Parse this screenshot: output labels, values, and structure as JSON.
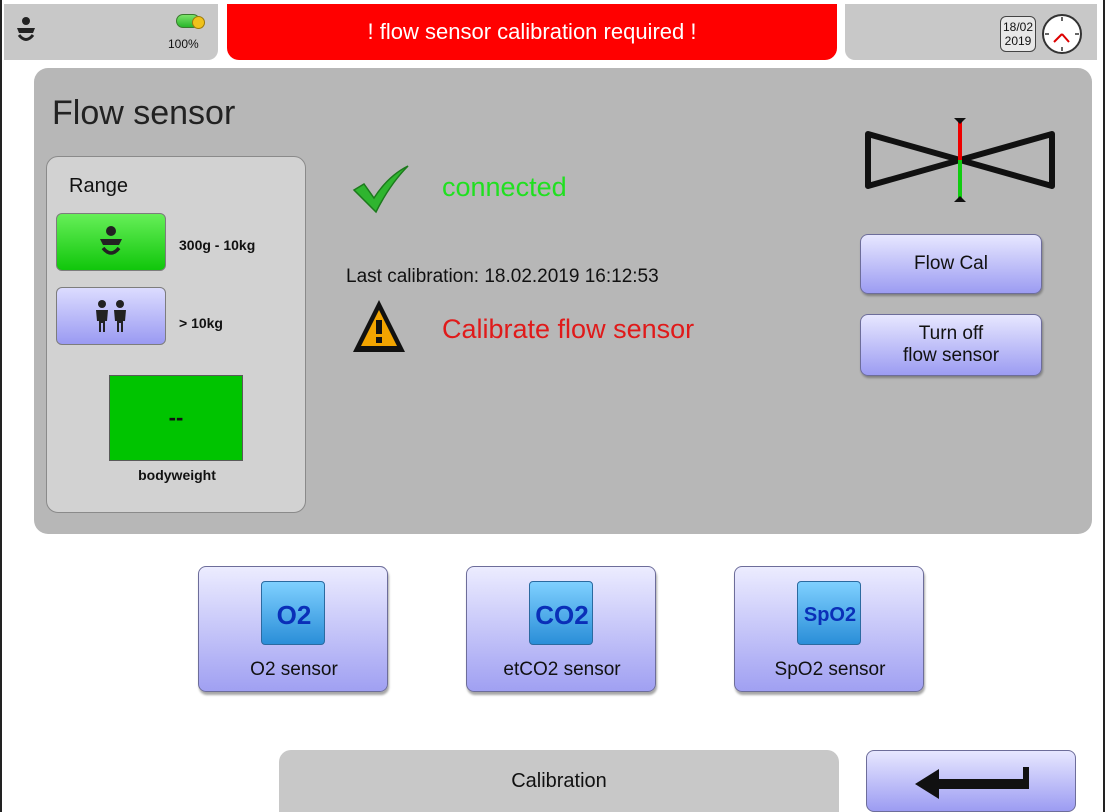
{
  "status_bar": {
    "battery_label": "100%",
    "alarm_message": "! flow sensor calibration required !",
    "date_line1": "18/02",
    "date_line2": "2019"
  },
  "panel": {
    "title": "Flow sensor",
    "range": {
      "title": "Range",
      "options": [
        {
          "label": "300g - 10kg",
          "selected": true,
          "icon": "infant-icon"
        },
        {
          "label": "> 10kg",
          "selected": false,
          "icon": "children-icon"
        }
      ],
      "bodyweight_value": "--",
      "bodyweight_label": "bodyweight"
    },
    "connection_status": "connected",
    "last_calibration": "Last calibration: 18.02.2019 16:12:53",
    "warning_message": "Calibrate flow sensor",
    "buttons": {
      "flow_cal": "Flow Cal",
      "turn_off": "Turn off\nflow sensor"
    }
  },
  "sensors": [
    {
      "icon_text": "O2",
      "label": "O2 sensor"
    },
    {
      "icon_text": "CO2",
      "label": "etCO2 sensor"
    },
    {
      "icon_text": "SpO2",
      "label": "SpO2 sensor"
    }
  ],
  "footer": {
    "title": "Calibration"
  },
  "colors": {
    "alarm": "#ff0000",
    "connected": "#20e020",
    "warning": "#e01a1a",
    "selected_green": "#10c60b",
    "button_lavender": "#a0a0f2",
    "panel_gray": "#b7b7b7"
  }
}
